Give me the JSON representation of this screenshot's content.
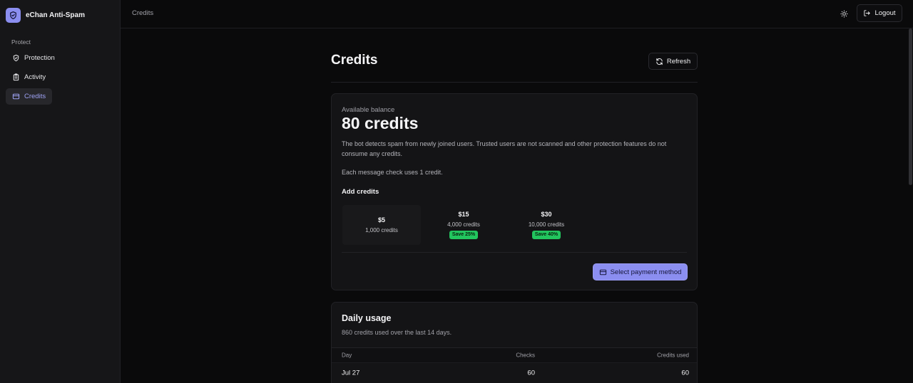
{
  "app": {
    "name": "eChan Anti-Spam",
    "accent": "#8b8ef0"
  },
  "sidebar": {
    "section": "Protect",
    "items": [
      {
        "label": "Protection",
        "icon": "shield-check-icon"
      },
      {
        "label": "Activity",
        "icon": "clipboard-icon"
      },
      {
        "label": "Credits",
        "icon": "credit-card-icon",
        "active": true
      }
    ]
  },
  "topbar": {
    "breadcrumb": "Credits",
    "theme_icon": "sun-icon",
    "logout_label": "Logout"
  },
  "page": {
    "title": "Credits",
    "refresh_label": "Refresh"
  },
  "balance": {
    "label": "Available balance",
    "value": "80 credits",
    "description": "The bot detects spam from newly joined users. Trusted users are not scanned and other protection features do not consume any credits.",
    "note": "Each message check uses 1 credit.",
    "add_title": "Add credits",
    "packs": [
      {
        "price": "$5",
        "credits": "1,000 credits",
        "badge": "",
        "selected": true
      },
      {
        "price": "$15",
        "credits": "4,000 credits",
        "badge": "Save 25%"
      },
      {
        "price": "$30",
        "credits": "10,000 credits",
        "badge": "Save 40%"
      }
    ],
    "pay_label": "Select payment method",
    "badge_color": "#22c55e"
  },
  "usage": {
    "title": "Daily usage",
    "subtitle": "860 credits used over the last 14 days.",
    "columns": {
      "day": "Day",
      "checks": "Checks",
      "credits_used": "Credits used"
    },
    "rows": [
      {
        "day": "Jul 27",
        "checks": "60",
        "credits_used": "60"
      }
    ]
  }
}
